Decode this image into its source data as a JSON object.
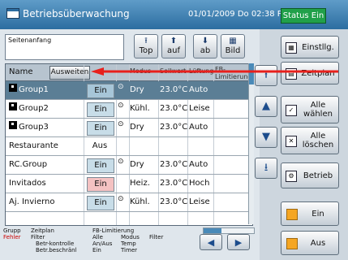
{
  "titlebar": {
    "title": "Betriebsüberwachung",
    "datetime": "01/01/2009 Do 02:38 PM",
    "status": "Status Ein"
  },
  "nav": {
    "home_label": "Seitenanfang",
    "top": "Top",
    "up": "auf",
    "down": "ab",
    "picture": "Bild"
  },
  "table": {
    "name_header": "Name",
    "expand_label": "Ausweiten",
    "col_headers": [
      "Modus",
      "Sollwert",
      "Lüftung",
      "FB-Limitierung"
    ],
    "rows": [
      {
        "name": "Group1",
        "group": true,
        "onoff": "Ein",
        "mode": "Dry",
        "temp": "23.0°C",
        "fan": "Auto",
        "selected": true
      },
      {
        "name": "Group2",
        "group": true,
        "onoff": "Ein",
        "mode": "Kühl.",
        "temp": "23.0°C",
        "fan": "Leise"
      },
      {
        "name": "Group3",
        "group": true,
        "onoff": "Ein",
        "mode": "Dry",
        "temp": "23.0°C",
        "fan": "Auto"
      },
      {
        "name": "Restaurante",
        "group": false,
        "onoff": "Aus",
        "mode": "",
        "temp": "",
        "fan": ""
      },
      {
        "name": "RC.Group",
        "group": false,
        "onoff": "Ein",
        "mode": "Dry",
        "temp": "23.0°C",
        "fan": "Auto"
      },
      {
        "name": "Invitados",
        "group": false,
        "onoff": "Ein",
        "mode": "Heiz.",
        "temp": "23.0°C",
        "fan": "Hoch",
        "red": true
      },
      {
        "name": "Aj. Invierno",
        "group": false,
        "onoff": "Ein",
        "mode": "Kühl.",
        "temp": "23.0°C",
        "fan": "Leise"
      }
    ]
  },
  "legend": {
    "grupp": "Grupp",
    "zeitplan": "Zeitplan",
    "fehler": "Fehler",
    "filter1": "Filter",
    "betr_kontrolle": "Betr-kontrolle",
    "betr_beschr": "Betr.beschränl",
    "fb_lim": "FB-Limitierung",
    "alle": "Alle",
    "modus": "Modus",
    "filter2": "Filter",
    "an_aus": "An/Aus",
    "temp": "Temp",
    "ein": "Ein",
    "timer": "Timer"
  },
  "side": {
    "settings": "Einstllg.",
    "schedule": "Zeitplan",
    "select_all": "Alle wählen",
    "clear_all": "Alle löschen",
    "operation": "Betrieb",
    "on": "Ein",
    "off": "Aus"
  },
  "colors": {
    "title": "#2c6da0",
    "status": "#21a04a",
    "accent": "#f5a623",
    "arrow": "#e8201c"
  }
}
